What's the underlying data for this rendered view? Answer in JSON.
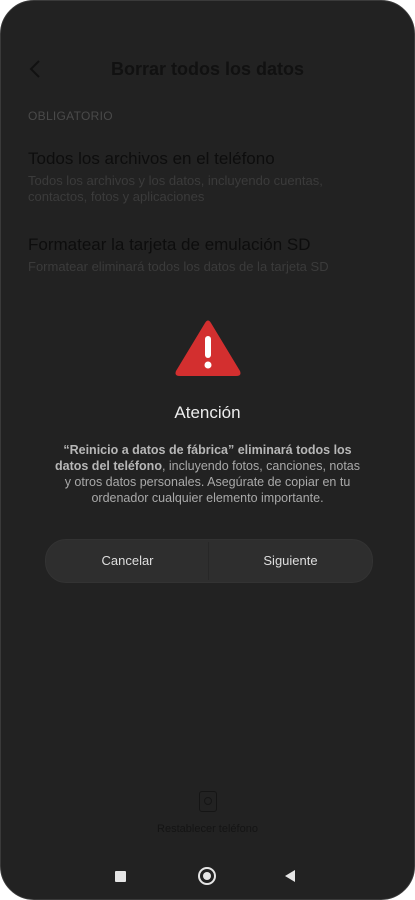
{
  "header": {
    "title": "Borrar todos los datos"
  },
  "section": {
    "label": "OBLIGATORIO"
  },
  "items": [
    {
      "title": "Todos los archivos en el teléfono",
      "desc": "Todos los archivos y los datos, incluyendo cuentas, contactos, fotos y aplicaciones"
    },
    {
      "title": "Formatear la tarjeta de emulación SD",
      "desc": "Formatear eliminará todos los datos de la tarjeta SD"
    }
  ],
  "reset": {
    "label": "Restablecer teléfono"
  },
  "dialog": {
    "title": "Atención",
    "msg_bold": "“Reinicio a datos de fábrica” eliminará todos los datos del teléfono",
    "msg_rest": ", incluyendo fotos, canciones, notas y otros datos personales. Asegúrate de copiar en tu ordenador cualquier elemento importante.",
    "cancel_label": "Cancelar",
    "next_label": "Siguiente",
    "warning_color": "#d32f2f"
  },
  "navbar": {
    "icons": [
      "recents-square-icon",
      "home-circle-icon",
      "back-triangle-icon"
    ]
  }
}
